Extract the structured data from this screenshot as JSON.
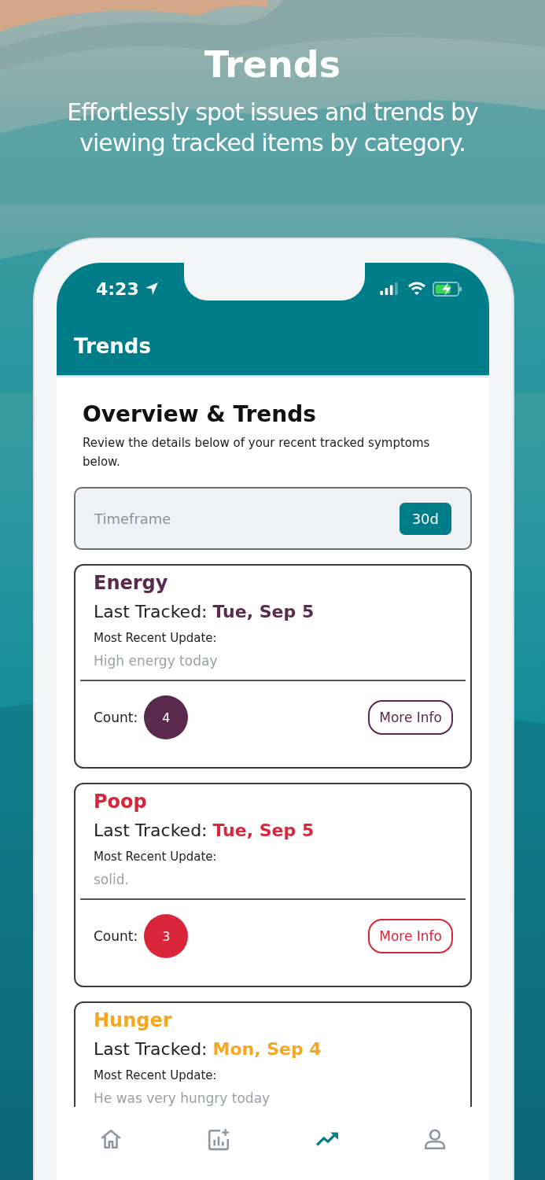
{
  "headline": "Trends",
  "subtitle": "Effortlessly spot issues and trends by viewing tracked items by category.",
  "status_bar": {
    "time": "4:23"
  },
  "app_bar": {
    "title": "Trends"
  },
  "overview": {
    "title": "Overview & Trends",
    "description": "Review the details below of your recent tracked symptoms below."
  },
  "timeframe": {
    "label": "Timeframe",
    "value": "30d"
  },
  "cards": [
    {
      "name": "Energy",
      "color": "#5a2a4e",
      "last_tracked_label": "Last Tracked:",
      "date": "Tue, Sep 5",
      "update_label": "Most Recent Update:",
      "update": "High energy today",
      "count_label": "Count:",
      "count": "4",
      "button": "More Info"
    },
    {
      "name": "Poop",
      "color": "#d9263a",
      "last_tracked_label": "Last Tracked:",
      "date": "Tue, Sep 5",
      "update_label": "Most Recent Update:",
      "update": "solid.",
      "count_label": "Count:",
      "count": "3",
      "button": "More Info"
    },
    {
      "name": "Hunger",
      "color": "#f5a623",
      "last_tracked_label": "Last Tracked:",
      "date": "Mon, Sep 4",
      "update_label": "Most Recent Update:",
      "update": "He was very hungry today"
    }
  ],
  "tabs": [
    {
      "kind": "home",
      "selected": false
    },
    {
      "kind": "add-chart",
      "selected": false
    },
    {
      "kind": "trends",
      "selected": true
    },
    {
      "kind": "profile",
      "selected": false
    }
  ]
}
